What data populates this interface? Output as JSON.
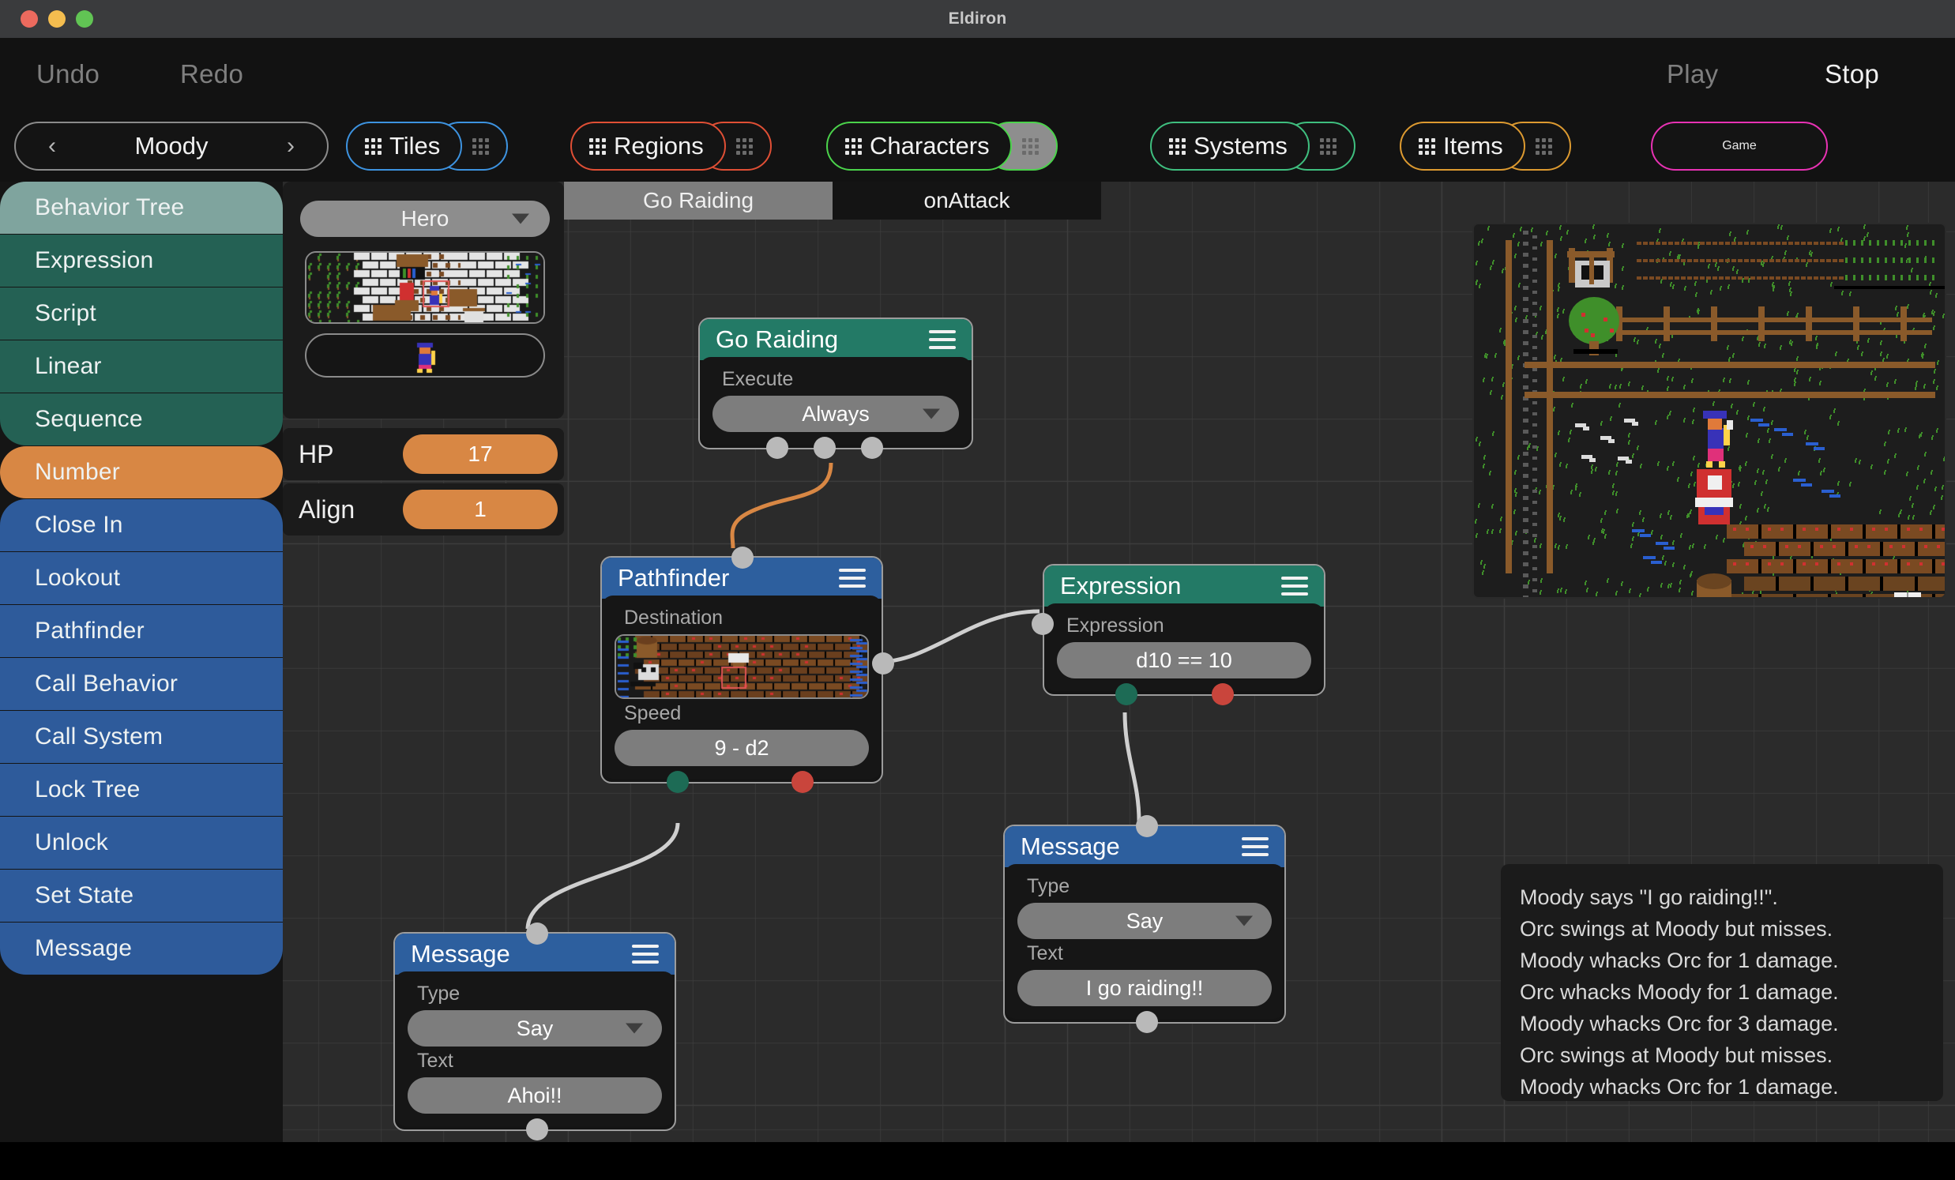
{
  "window": {
    "title": "Eldiron",
    "traffic_lights": [
      "close-red",
      "minimize-yellow",
      "maximize-green"
    ]
  },
  "toolbar": {
    "undo": "Undo",
    "redo": "Redo",
    "play": "Play",
    "stop": "Stop",
    "nav": {
      "prev": "‹",
      "label": "Moody",
      "next": "›"
    },
    "pills": [
      {
        "label": "Tiles",
        "color": "#3d93e0",
        "side_active": false
      },
      {
        "label": "Regions",
        "color": "#e04f35",
        "side_active": false
      },
      {
        "label": "Characters",
        "color": "#4bd34b",
        "side_active": true
      },
      {
        "label": "Systems",
        "color": "#3fbf7f",
        "side_active": false
      },
      {
        "label": "Items",
        "color": "#dd9a30",
        "side_active": false
      }
    ],
    "game_pill": {
      "label": "Game",
      "color": "#e832b4"
    }
  },
  "sidebar": {
    "items": [
      {
        "label": "Behavior Tree",
        "group": "teal",
        "selected": true
      },
      {
        "label": "Expression",
        "group": "teal",
        "selected": false
      },
      {
        "label": "Script",
        "group": "teal",
        "selected": false
      },
      {
        "label": "Linear",
        "group": "teal",
        "selected": false
      },
      {
        "label": "Sequence",
        "group": "teal",
        "selected": false
      },
      {
        "label": "Number",
        "group": "orange",
        "selected": true
      },
      {
        "label": "Close In",
        "group": "blue",
        "selected": false
      },
      {
        "label": "Lookout",
        "group": "blue",
        "selected": false
      },
      {
        "label": "Pathfinder",
        "group": "blue",
        "selected": false
      },
      {
        "label": "Call Behavior",
        "group": "blue",
        "selected": false
      },
      {
        "label": "Call System",
        "group": "blue",
        "selected": false
      },
      {
        "label": "Lock Tree",
        "group": "blue",
        "selected": false
      },
      {
        "label": "Unlock",
        "group": "blue",
        "selected": false
      },
      {
        "label": "Set State",
        "group": "blue",
        "selected": false
      },
      {
        "label": "Message",
        "group": "blue",
        "selected": false
      }
    ],
    "colors": {
      "teal": "#246154",
      "teal_selected": "#7fa49e",
      "orange": "#d88744",
      "blue": "#2e5b9b"
    }
  },
  "character_panel": {
    "dropdown_value": "Hero",
    "map_preview_alt": "region-tile-preview",
    "sprite_preview_alt": "character-sprite-preview",
    "stats": [
      {
        "name": "HP",
        "value": "17"
      },
      {
        "name": "Align",
        "value": "1"
      }
    ]
  },
  "tabs": [
    {
      "label": "Go Raiding",
      "active": true
    },
    {
      "label": "onAttack",
      "active": false
    }
  ],
  "nodes": {
    "go_raiding": {
      "title": "Go Raiding",
      "head_color": "teal",
      "fields": [
        {
          "label": "Execute",
          "value": "Always",
          "type": "dropdown"
        }
      ]
    },
    "pathfinder": {
      "title": "Pathfinder",
      "head_color": "blue",
      "destination_label": "Destination",
      "speed_label": "Speed",
      "speed_value": "9 - d2"
    },
    "expression": {
      "title": "Expression",
      "head_color": "teal",
      "fields": [
        {
          "label": "Expression",
          "value": "d10 == 10",
          "type": "text"
        }
      ]
    },
    "message_right": {
      "title": "Message",
      "head_color": "blue",
      "fields": [
        {
          "label": "Type",
          "value": "Say",
          "type": "dropdown"
        },
        {
          "label": "Text",
          "value": "I go raiding!!",
          "type": "text"
        }
      ]
    },
    "message_left": {
      "title": "Message",
      "head_color": "blue",
      "fields": [
        {
          "label": "Type",
          "value": "Say",
          "type": "dropdown"
        },
        {
          "label": "Text",
          "value": "Ahoi!!",
          "type": "text"
        }
      ]
    }
  },
  "log": {
    "lines": [
      "Moody says \"I go raiding!!\".",
      "Orc swings at Moody but misses.",
      "Moody whacks Orc for 1 damage.",
      "Orc whacks Moody for 1 damage.",
      "Moody whacks Orc for 3 damage.",
      "Orc swings at Moody but misses.",
      "Moody whacks Orc for 1 damage."
    ]
  },
  "game_preview": {
    "alt": "pixel-art-game-viewport"
  }
}
